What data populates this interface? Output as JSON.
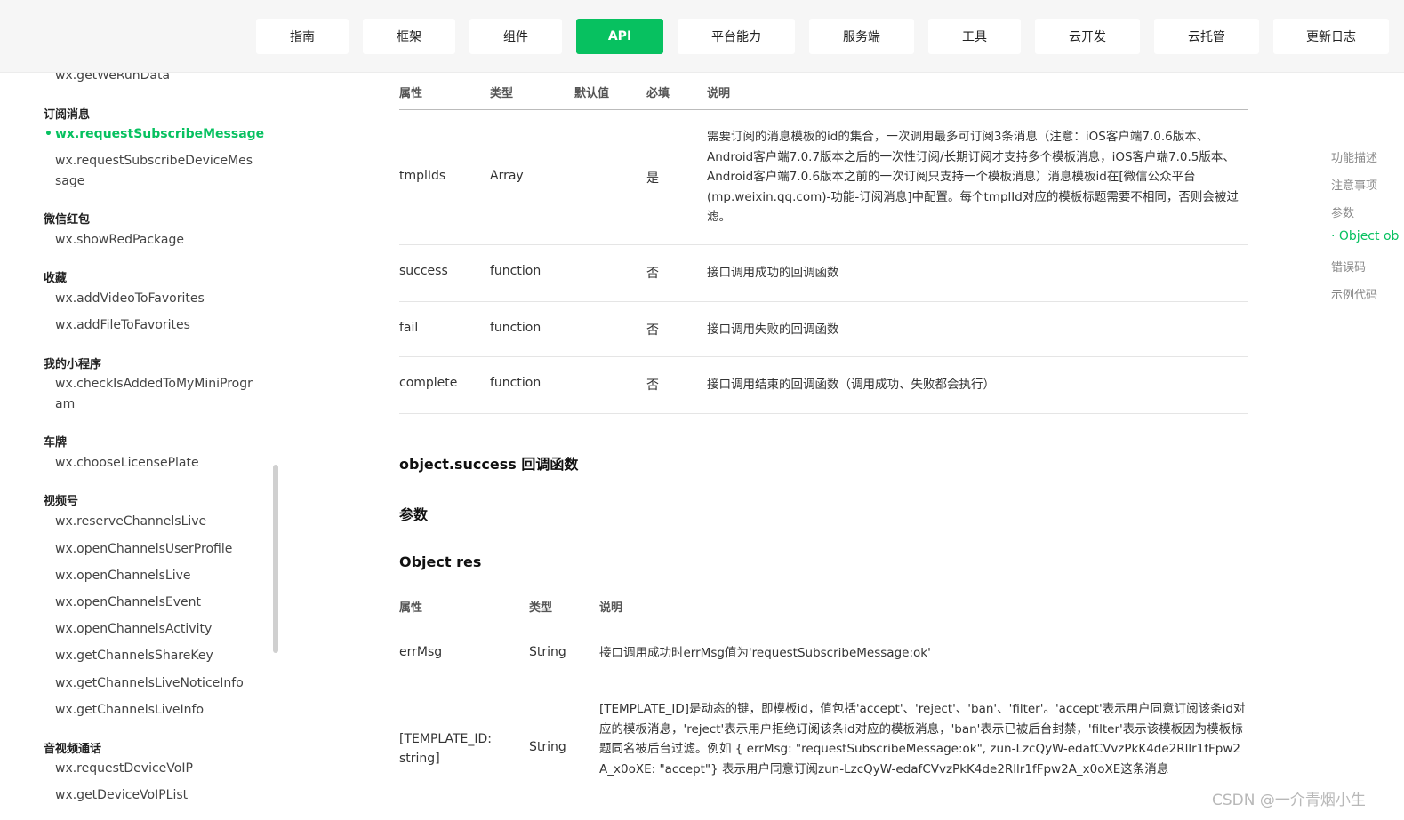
{
  "nav": {
    "tabs": [
      "指南",
      "框架",
      "组件",
      "API",
      "平台能力",
      "服务端",
      "工具",
      "云开发",
      "云托管",
      "更新日志"
    ],
    "active": "API"
  },
  "sidebar": {
    "top_cut": "wx.getWeRunData",
    "groups": [
      {
        "title": "订阅消息",
        "items": [
          "wx.requestSubscribeMessage",
          "wx.requestSubscribeDeviceMessage"
        ]
      },
      {
        "title": "微信红包",
        "items": [
          "wx.showRedPackage"
        ]
      },
      {
        "title": "收藏",
        "items": [
          "wx.addVideoToFavorites",
          "wx.addFileToFavorites"
        ]
      },
      {
        "title": "我的小程序",
        "items": [
          "wx.checkIsAddedToMyMiniProgram"
        ]
      },
      {
        "title": "车牌",
        "items": [
          "wx.chooseLicensePlate"
        ]
      },
      {
        "title": "视频号",
        "items": [
          "wx.reserveChannelsLive",
          "wx.openChannelsUserProfile",
          "wx.openChannelsLive",
          "wx.openChannelsEvent",
          "wx.openChannelsActivity",
          "wx.getChannelsShareKey",
          "wx.getChannelsLiveNoticeInfo",
          "wx.getChannelsLiveInfo"
        ]
      },
      {
        "title": "音视频通话",
        "items": [
          "wx.requestDeviceVoIP",
          "wx.getDeviceVoIPList"
        ]
      }
    ],
    "active_item": "wx.requestSubscribeMessage"
  },
  "params_table": {
    "headers": [
      "属性",
      "类型",
      "默认值",
      "必填",
      "说明"
    ],
    "rows": [
      {
        "name": "tmplIds",
        "type": "Array",
        "default": "",
        "required": "是",
        "desc": "需要订阅的消息模板的id的集合，一次调用最多可订阅3条消息（注意：iOS客户端7.0.6版本、Android客户端7.0.7版本之后的一次性订阅/长期订阅才支持多个模板消息，iOS客户端7.0.5版本、Android客户端7.0.6版本之前的一次订阅只支持一个模板消息）消息模板id在[微信公众平台(mp.weixin.qq.com)-功能-订阅消息]中配置。每个tmplId对应的模板标题需要不相同，否则会被过滤。"
      },
      {
        "name": "success",
        "type": "function",
        "default": "",
        "required": "否",
        "desc": "接口调用成功的回调函数"
      },
      {
        "name": "fail",
        "type": "function",
        "default": "",
        "required": "否",
        "desc": "接口调用失败的回调函数"
      },
      {
        "name": "complete",
        "type": "function",
        "default": "",
        "required": "否",
        "desc": "接口调用结束的回调函数（调用成功、失败都会执行）"
      }
    ]
  },
  "headings": {
    "success_cb": "object.success 回调函数",
    "params": "参数",
    "object_res": "Object res"
  },
  "res_table": {
    "headers": [
      "属性",
      "类型",
      "说明"
    ],
    "rows": [
      {
        "name": "errMsg",
        "type": "String",
        "desc": "接口调用成功时errMsg值为'requestSubscribeMessage:ok'"
      },
      {
        "name": "[TEMPLATE_ID: string]",
        "type": "String",
        "desc": "[TEMPLATE_ID]是动态的键，即模板id，值包括'accept'、'reject'、'ban'、'filter'。'accept'表示用户同意订阅该条id对应的模板消息，'reject'表示用户拒绝订阅该条id对应的模板消息，'ban'表示已被后台封禁，'filter'表示该模板因为模板标题同名被后台过滤。例如 { errMsg: \"requestSubscribeMessage:ok\", zun-LzcQyW-edafCVvzPkK4de2Rllr1fFpw2A_x0oXE: \"accept\"} 表示用户同意订阅zun-LzcQyW-edafCVvzPkK4de2Rllr1fFpw2A_x0oXE这条消息"
      }
    ]
  },
  "toc": {
    "items": [
      "功能描述",
      "注意事项",
      "参数",
      "· Object ob",
      "错误码",
      "示例代码"
    ],
    "active_index": 3
  },
  "watermark": "CSDN @一介青烟小生",
  "colors": {
    "accent": "#07c160"
  }
}
